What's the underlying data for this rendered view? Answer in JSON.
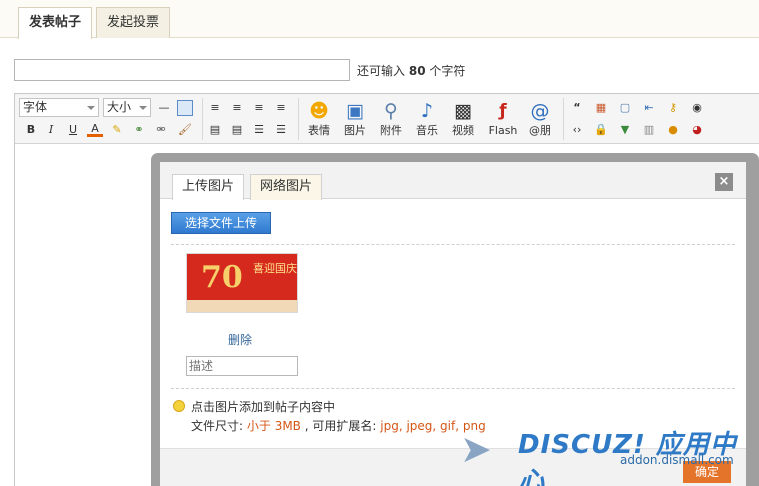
{
  "tabs": [
    "发表帖子",
    "发起投票"
  ],
  "title_field": {
    "value": "",
    "hint_prefix": "还可输入",
    "hint_count": "80",
    "hint_suffix": "个字符"
  },
  "toolbar": {
    "font_label": "字体",
    "size_label": "大小",
    "format_buttons": [
      "B",
      "I",
      "U",
      "A"
    ],
    "insert_labels": [
      "表情",
      "图片",
      "附件",
      "音乐",
      "视频",
      "Flash",
      "@朋"
    ]
  },
  "dialog": {
    "tabs": [
      "上传图片",
      "网络图片"
    ],
    "upload_button": "选择文件上传",
    "delete_link": "删除",
    "desc_placeholder": "描述",
    "tip_line1": "点击图片添加到帖子内容中",
    "size_label": "文件尺寸:",
    "size_value": "小于 3MB",
    "ext_label": ", 可用扩展名:",
    "ext_value": "jpg, jpeg, gif, png",
    "ok_button": "确定",
    "thumb_caption": "喜迎国庆"
  },
  "watermark": {
    "brand": "DISCUZ! 应用中心",
    "url": "addon.dismall.com"
  },
  "colors": {
    "accent_blue": "#2f7ad0",
    "highlight": "#d45617"
  }
}
